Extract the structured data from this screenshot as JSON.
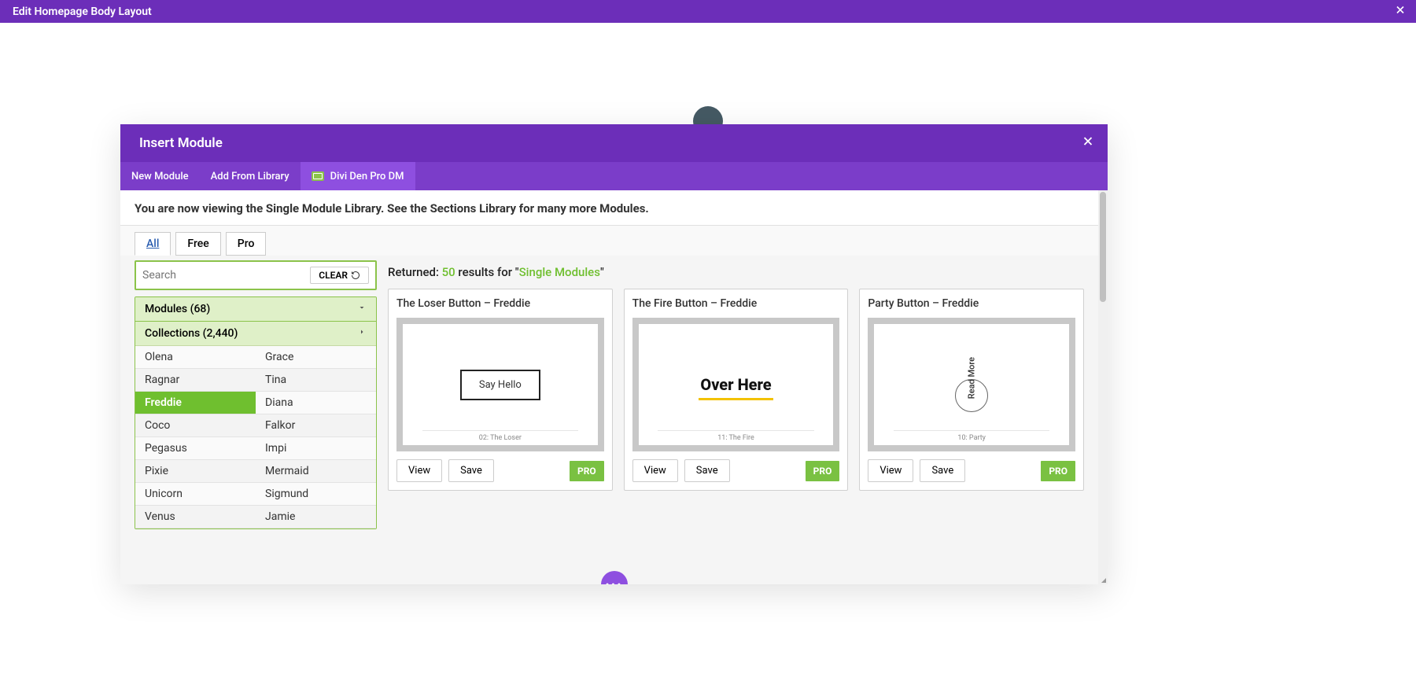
{
  "topBar": {
    "title": "Edit Homepage Body Layout"
  },
  "modal": {
    "title": "Insert Module",
    "tabs": [
      {
        "label": "New Module",
        "active": false
      },
      {
        "label": "Add From Library",
        "active": false
      },
      {
        "label": "Divi Den Pro DM",
        "active": true,
        "hasIcon": true
      }
    ],
    "notice": "You are now viewing the Single Module Library. See the Sections Library for many more Modules.",
    "filterTabs": [
      {
        "label": "All",
        "active": true
      },
      {
        "label": "Free",
        "active": false
      },
      {
        "label": "Pro",
        "active": false
      }
    ],
    "search": {
      "placeholder": "Search",
      "clearLabel": "CLEAR"
    },
    "accordion": {
      "modules": {
        "label": "Modules (68)"
      },
      "collections": {
        "label": "Collections (2,440)"
      }
    },
    "collectionsGrid": [
      "Olena",
      "Grace",
      "Ragnar",
      "Tina",
      "Freddie",
      "Diana",
      "Coco",
      "Falkor",
      "Pegasus",
      "Impi",
      "Pixie",
      "Mermaid",
      "Unicorn",
      "Sigmund",
      "Venus",
      "Jamie"
    ],
    "selectedCollection": "Freddie",
    "returned": {
      "prefix": "Returned: ",
      "count": "50",
      "mid": " results for \"",
      "term": "Single Modules",
      "suffix": "\""
    },
    "cards": [
      {
        "title": "The Loser Button – Freddie",
        "previewType": "sayhello",
        "previewText": "Say Hello",
        "footerLabel": "02: The Loser",
        "view": "View",
        "save": "Save",
        "badge": "PRO"
      },
      {
        "title": "The Fire Button – Freddie",
        "previewType": "overhere",
        "previewText": "Over Here",
        "footerLabel": "11: The Fire",
        "view": "View",
        "save": "Save",
        "badge": "PRO"
      },
      {
        "title": "Party Button – Freddie",
        "previewType": "readmore",
        "previewText": "Read More",
        "footerLabel": "10: Party",
        "view": "View",
        "save": "Save",
        "badge": "PRO"
      }
    ]
  }
}
